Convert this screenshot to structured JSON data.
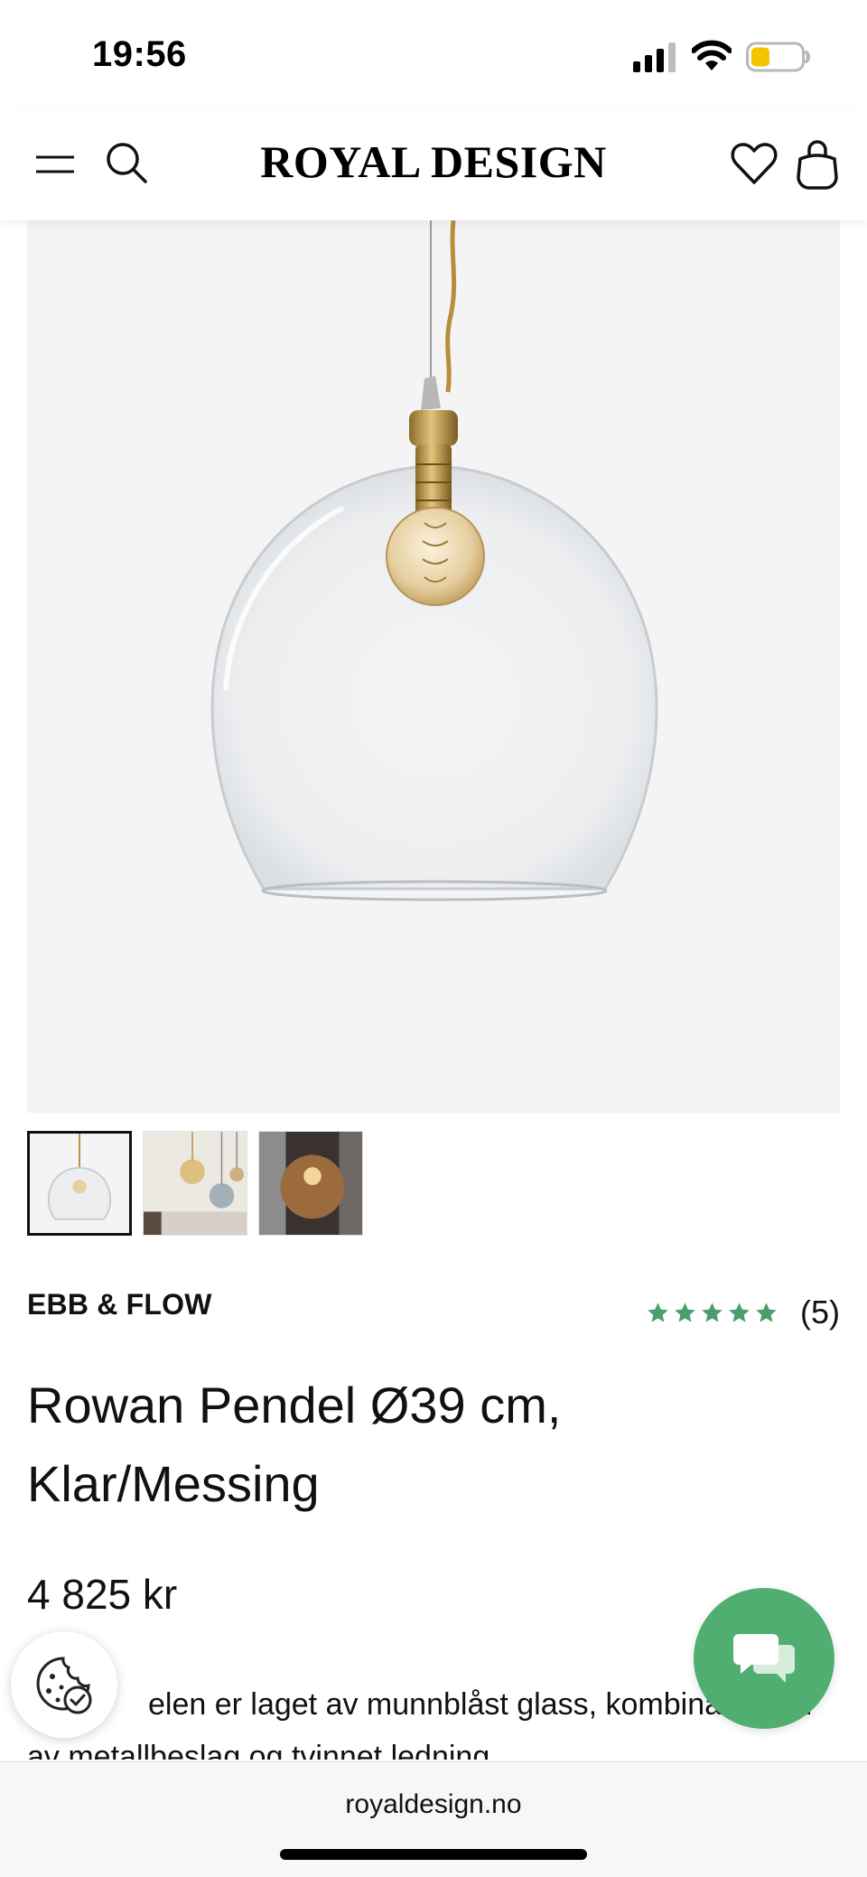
{
  "status_bar": {
    "time": "19:56",
    "icons": [
      "signal-icon",
      "wifi-icon",
      "battery-icon"
    ],
    "battery_color": "#f5c400"
  },
  "header": {
    "brand": "ROYAL DESIGN",
    "icons": [
      "menu-icon",
      "search-icon",
      "heart-icon",
      "bag-icon"
    ]
  },
  "gallery": {
    "thumbnail_count": 3,
    "active_index": 0
  },
  "product": {
    "brand": "EBB & FLOW",
    "rating": 5,
    "review_count": "(5)",
    "title": "Rowan Pendel Ø39 cm, Klar/Messing",
    "price": "4 825 kr",
    "description": "elen er laget av munnblåst glass, kombinasjonen av metallbeslag og tvinnet ledning"
  },
  "floating": {
    "cookie_icon": "cookie-settings-icon",
    "chat_icon": "chat-bubbles-icon"
  },
  "browser": {
    "url": "royaldesign.no"
  },
  "colors": {
    "accent_green": "#4fae70",
    "star_green": "#4a9d6c",
    "image_background": "#f4f4f5"
  }
}
